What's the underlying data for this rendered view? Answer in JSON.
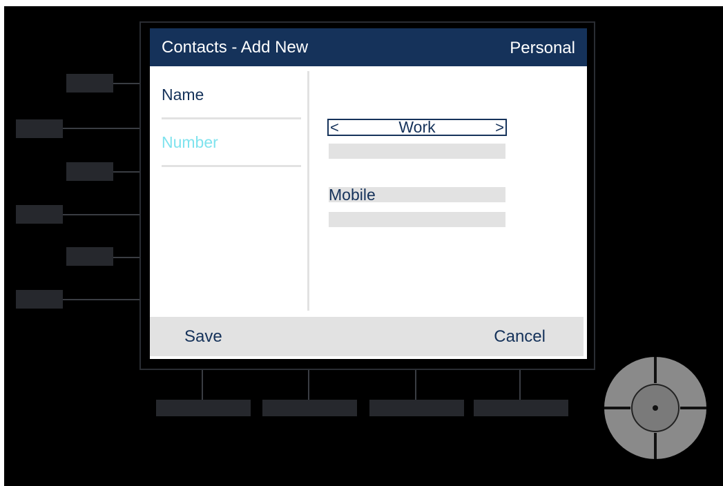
{
  "header": {
    "title": "Contacts - Add New",
    "mode": "Personal"
  },
  "fields": [
    {
      "label": "Name",
      "active": false
    },
    {
      "label": "Number",
      "active": true
    }
  ],
  "number_type_selector": {
    "prev": "<",
    "value": "Work",
    "next": ">"
  },
  "number_entries": [
    {
      "type_label": ""
    },
    {
      "type_label": "Mobile"
    }
  ],
  "softkeys": {
    "left": "Save",
    "right": "Cancel"
  },
  "colors": {
    "title_bg": "#15325a",
    "text": "#15325a",
    "active_field": "#7fe3ee",
    "input_bg": "#e2e2e2",
    "device_bg": "#000000"
  },
  "icons": {
    "nav_pad": "navigation-pad-icon"
  }
}
